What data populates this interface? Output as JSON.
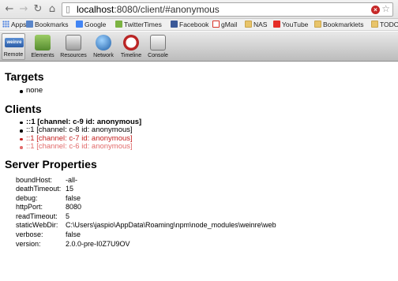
{
  "browser": {
    "url_host": "localhost",
    "url_path": ":8080/client/#anonymous",
    "ext_badge": "×",
    "icons": [
      "back-arrow-icon",
      "forward-arrow-icon",
      "reload-icon",
      "home-icon",
      "page-icon",
      "star-icon"
    ]
  },
  "bookmarks": [
    {
      "label": "Apps",
      "icon": "apps-grid-icon"
    },
    {
      "label": "Bookmarks",
      "icon": "folder-icon"
    },
    {
      "label": "Google",
      "icon": "google-icon"
    },
    {
      "label": "TwitterTimes",
      "icon": "twittertimes-icon"
    },
    {
      "label": "Facebook",
      "icon": "facebook-icon"
    },
    {
      "label": "gMail",
      "icon": "gmail-icon"
    },
    {
      "label": "NAS",
      "icon": "folder-icon"
    },
    {
      "label": "YouTube",
      "icon": "youtube-icon"
    },
    {
      "label": "Bookmarklets",
      "icon": "folder-icon"
    },
    {
      "label": "TODO",
      "icon": "folder-icon"
    }
  ],
  "toolbar": {
    "remote_logo": "weinre",
    "remote_label": "Remote",
    "elements_label": "Elements",
    "resources_label": "Resources",
    "network_label": "Network",
    "timeline_label": "Timeline",
    "console_label": "Console"
  },
  "colors": {
    "selected_client": "#000000",
    "stale_client": "#c42020",
    "old_client": "#e26b6b"
  },
  "targets": {
    "heading": "Targets",
    "items": [
      "none"
    ]
  },
  "clients": {
    "heading": "Clients",
    "items": [
      "::1 [channel: c-9 id: anonymous]",
      "::1 [channel: c-8 id: anonymous]",
      "::1 [channel: c-7 id: anonymous]",
      "::1 [channel: c-6 id: anonymous]"
    ]
  },
  "server": {
    "heading": "Server Properties",
    "props": [
      {
        "key": "boundHost:",
        "value": "-all-"
      },
      {
        "key": "deathTimeout:",
        "value": "15"
      },
      {
        "key": "debug:",
        "value": "false"
      },
      {
        "key": "httpPort:",
        "value": "8080"
      },
      {
        "key": "readTimeout:",
        "value": "5"
      },
      {
        "key": "staticWebDir:",
        "value": "C:\\Users\\jaspio\\AppData\\Roaming\\npm\\node_modules\\weinre\\web"
      },
      {
        "key": "verbose:",
        "value": "false"
      },
      {
        "key": "version:",
        "value": "2.0.0-pre-I0Z7U9OV"
      }
    ]
  }
}
